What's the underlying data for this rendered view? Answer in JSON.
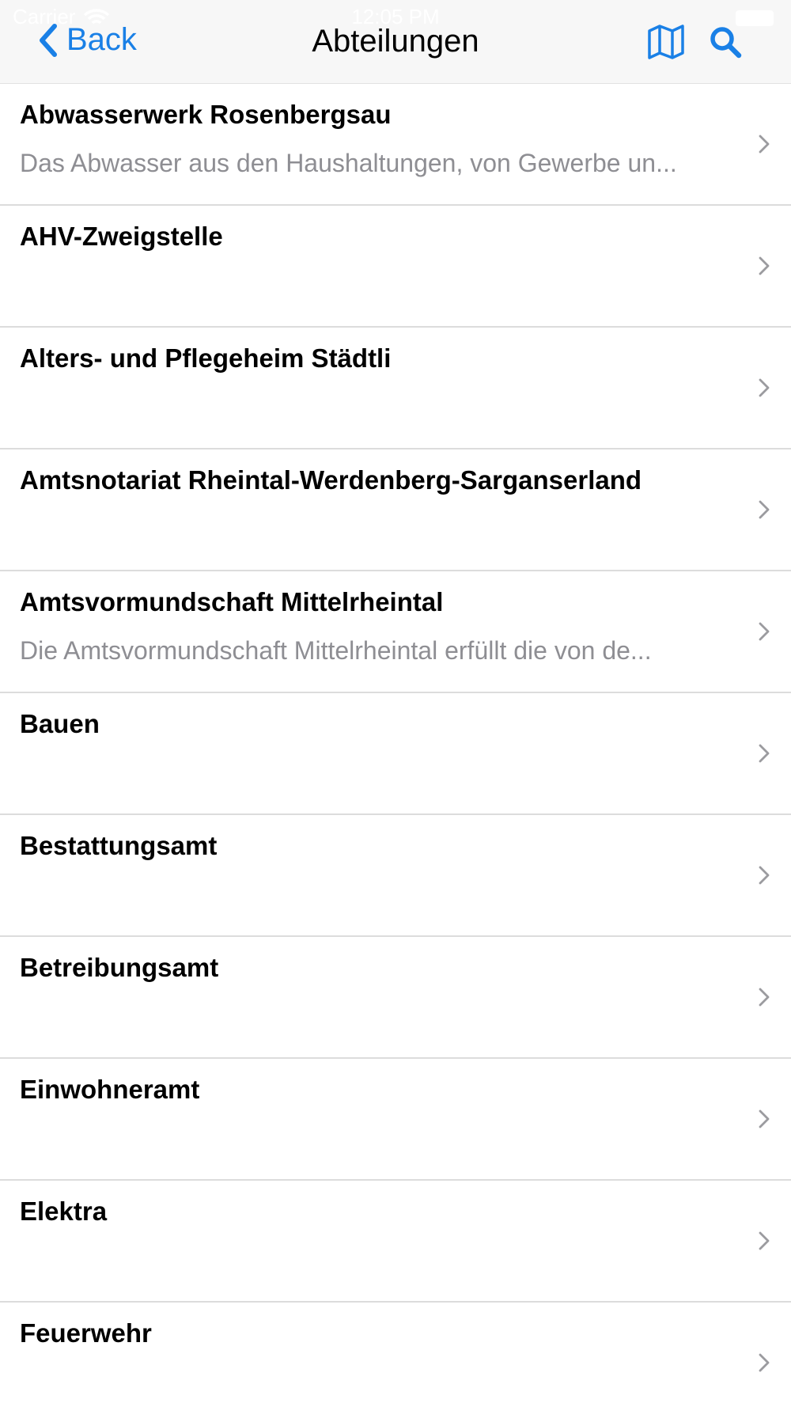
{
  "status_bar": {
    "carrier": "Carrier",
    "time": "12:05 PM"
  },
  "nav": {
    "back_label": "Back",
    "title": "Abteilungen",
    "map_icon": "map-icon",
    "search_icon": "search-icon"
  },
  "colors": {
    "accent": "#1a80e6",
    "nav_background": "#f7f7f7",
    "subtitle": "#8e8e93",
    "separator": "#dcdcdc",
    "chevron": "#9b9b9f"
  },
  "rows": [
    {
      "title": "Abwasserwerk Rosenbergsau",
      "subtitle": "Das Abwasser aus den Haushaltungen, von Gewerbe un..."
    },
    {
      "title": "AHV-Zweigstelle",
      "subtitle": ""
    },
    {
      "title": "Alters- und Pflegeheim Städtli",
      "subtitle": ""
    },
    {
      "title": "Amtsnotariat Rheintal-Werdenberg-Sarganserland",
      "subtitle": ""
    },
    {
      "title": "Amtsvormundschaft Mittelrheintal",
      "subtitle": "Die Amtsvormundschaft Mittelrheintal erfüllt die von de..."
    },
    {
      "title": "Bauen",
      "subtitle": ""
    },
    {
      "title": "Bestattungsamt",
      "subtitle": ""
    },
    {
      "title": "Betreibungsamt",
      "subtitle": ""
    },
    {
      "title": "Einwohneramt",
      "subtitle": ""
    },
    {
      "title": "Elektra",
      "subtitle": ""
    },
    {
      "title": "Feuerwehr",
      "subtitle": ""
    }
  ]
}
